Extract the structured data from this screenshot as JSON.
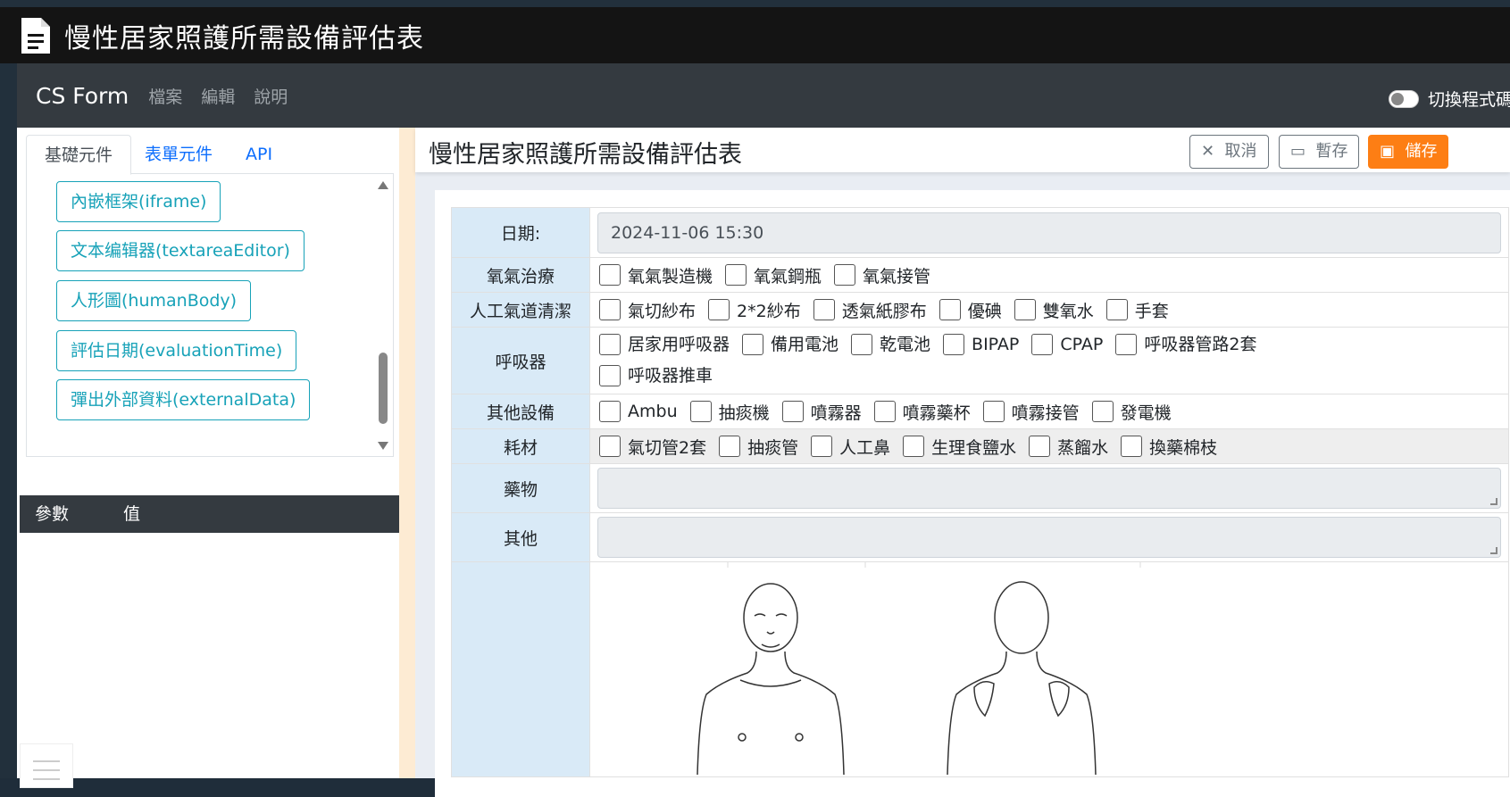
{
  "window": {
    "title": "慢性居家照護所需設備評估表"
  },
  "nav": {
    "brand": "CS Form",
    "menu": [
      "檔案",
      "編輯",
      "說明"
    ],
    "toggle_label": "切換程式碼"
  },
  "left": {
    "tabs": [
      "基礎元件",
      "表單元件",
      "API"
    ],
    "components": [
      "內嵌框架(iframe)",
      "文本编辑器(textareaEditor)",
      "人形圖(humanBody)",
      "評估日期(evaluationTime)",
      "彈出外部資料(externalData)"
    ],
    "param_header": {
      "param": "參數",
      "value": "值"
    }
  },
  "main": {
    "title": "慢性居家照護所需設備評估表",
    "buttons": {
      "cancel": "取消",
      "draft": "暫存",
      "save": "儲存"
    }
  },
  "form": {
    "date_label": "日期:",
    "date_value": "2024-11-06 15:30",
    "rows": [
      {
        "label": "氧氣治療",
        "options": [
          "氧氣製造機",
          "氧氣鋼瓶",
          "氧氣接管"
        ]
      },
      {
        "label": "人工氣道清潔",
        "options": [
          "氣切紗布",
          "2*2紗布",
          "透氣紙膠布",
          "優碘",
          "雙氧水",
          "手套"
        ]
      },
      {
        "label": "呼吸器",
        "options": [
          "居家用呼吸器",
          "備用電池",
          "乾電池",
          "BIPAP",
          "CPAP",
          "呼吸器管路2套",
          "呼吸器推車"
        ]
      },
      {
        "label": "其他設備",
        "options": [
          "Ambu",
          "抽痰機",
          "噴霧器",
          "噴霧藥杯",
          "噴霧接管",
          "發電機"
        ]
      },
      {
        "label": "耗材",
        "options": [
          "氣切管2套",
          "抽痰管",
          "人工鼻",
          "生理食鹽水",
          "蒸餾水",
          "換藥棉枝"
        ]
      }
    ],
    "medicine_label": "藥物",
    "other_label": "其他"
  }
}
